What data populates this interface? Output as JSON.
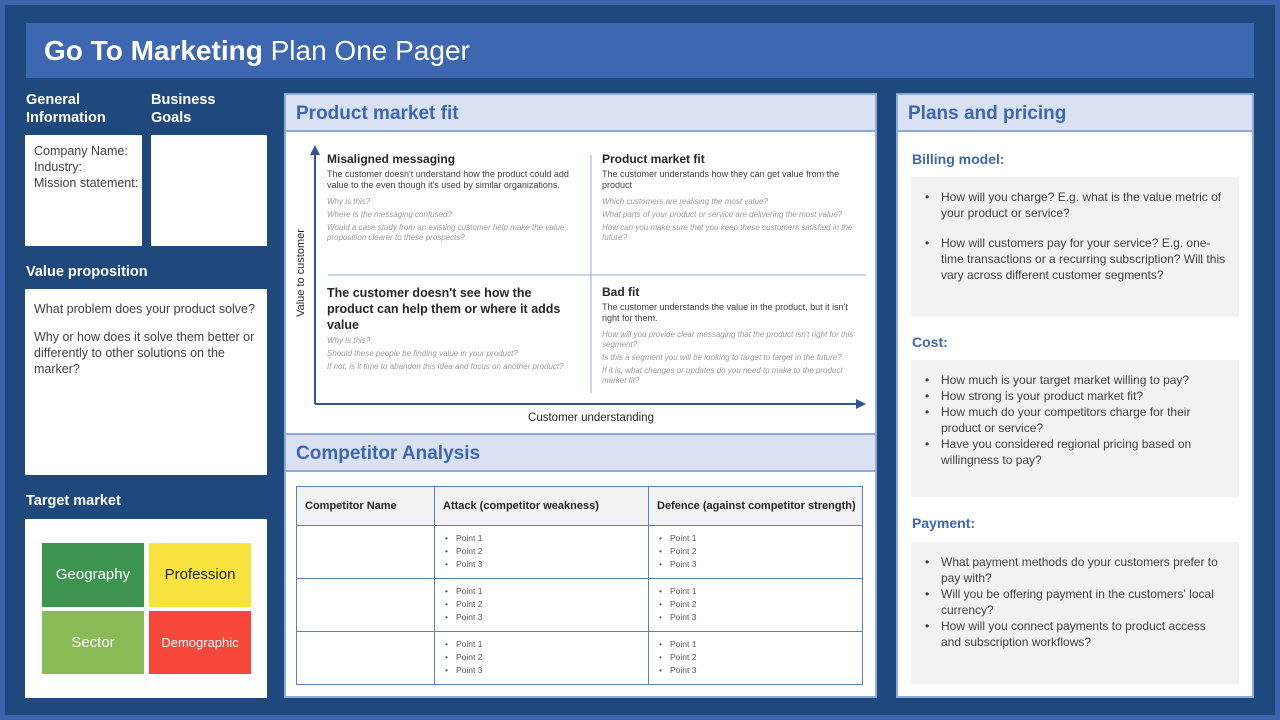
{
  "header": {
    "title_bold": "Go To Marketing",
    "title_rest": " Plan One Pager"
  },
  "left": {
    "general_info": {
      "label_line1": "General",
      "label_line2": "Information",
      "lines": [
        "Company Name:",
        "Industry:",
        "Mission statement:"
      ]
    },
    "business_goals": {
      "label_line1": "Business",
      "label_line2": "Goals"
    },
    "value_proposition": {
      "label": "Value proposition",
      "q1": "What problem does your product solve?",
      "q2": "Why or how does it solve them better or differently to other solutions on the marker?"
    },
    "target_market": {
      "label": "Target market",
      "tiles": [
        {
          "label": "Geography",
          "color": "#3d944e"
        },
        {
          "label": "Profession",
          "color": "#f9e33f"
        },
        {
          "label": "Sector",
          "color": "#8bbb57"
        },
        {
          "label": "Demographic",
          "color": "#f7473a"
        }
      ]
    }
  },
  "pmf": {
    "title": "Product market fit",
    "y_axis": "Value to customer",
    "x_axis": "Customer understanding",
    "quadrants": [
      {
        "title": "Misaligned  messaging",
        "desc": "The customer doesn't understand  how the product  could add value to the even though  it's used by similar organizations.",
        "questions": [
          "Why is this?",
          "Where is the messaging confused?",
          "Would a case study from an existing customer help make the value proposition clearer to these prospects?"
        ]
      },
      {
        "title": "Product market fit",
        "desc": "The customer understands  how they can get value from the product",
        "questions": [
          "Which customers are realising the most value?",
          "What parts of your product  or service are delivering the most value?",
          "How can you make sure that you keep these customers satisfied in the future?"
        ]
      },
      {
        "title": "The customer doesn't see how the product can help them or where it adds value",
        "desc": "",
        "questions": [
          "Why is this?",
          "Should these people be finding value in your product?",
          "If not, is it time to abandon this idea and focus on another product?"
        ]
      },
      {
        "title": "Bad fit",
        "desc": "The customer understands  the value in the product,  but it isn't right for them.",
        "questions": [
          "How will you provide clear messaging that the product  isn't right for this segment?",
          "Is this a segment you will be looking to target to target in the future?",
          "If it is, what changes or updates do you need to make to the product market fit?"
        ]
      }
    ]
  },
  "competitor": {
    "title": "Competitor Analysis",
    "headers": [
      "Competitor Name",
      "Attack (competitor weakness)",
      "Defence (against competitor strength)"
    ],
    "rows": [
      {
        "name": "",
        "attack": [
          "Point 1",
          "Point 2",
          "Point 3"
        ],
        "defence": [
          "Point 1",
          "Point 2",
          "Point 3"
        ]
      },
      {
        "name": "",
        "attack": [
          "Point 1",
          "Point 2",
          "Point 3"
        ],
        "defence": [
          "Point 1",
          "Point 2",
          "Point 3"
        ]
      },
      {
        "name": "",
        "attack": [
          "Point 1",
          "Point 2",
          "Point 3"
        ],
        "defence": [
          "Point 1",
          "Point 2",
          "Point 3"
        ]
      }
    ]
  },
  "pricing": {
    "title": "Plans and pricing",
    "billing": {
      "label": "Billing model:",
      "items": [
        "How will you charge? E.g. what is the value metric of your product or service?",
        "How will customers pay for your service? E.g. one-time transactions or a recurring subscription? Will this vary across different customer segments?"
      ]
    },
    "cost": {
      "label": "Cost:",
      "items": [
        "How much is your target market willing to pay?",
        "How strong is your product market fit?",
        "How much do your competitors charge for their product or service?",
        "Have you considered regional pricing based on willingness to pay?"
      ]
    },
    "payment": {
      "label": "Payment:",
      "items": [
        "What payment methods do your customers prefer to pay with?",
        "Will you be offering payment in the customers' local currency?",
        "How will you connect payments to product access and subscription workflows?"
      ]
    }
  }
}
